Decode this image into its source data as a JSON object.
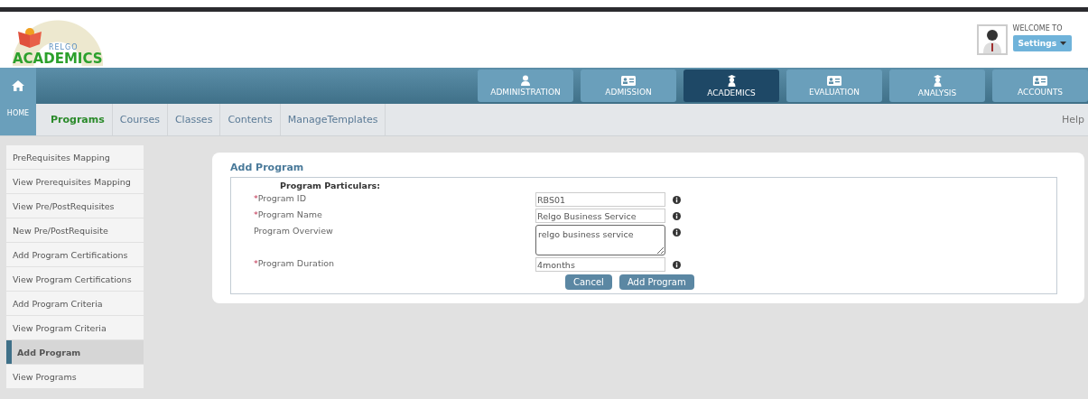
{
  "logo": {
    "brand": "RELGO",
    "name": "ACADEMICS"
  },
  "user": {
    "greeting": "WELCOME TO",
    "menu": "Settings"
  },
  "home": {
    "label": "HOME"
  },
  "modules": [
    {
      "label": "ADMINISTRATION",
      "kind": "person",
      "selected": false
    },
    {
      "label": "ADMISSION",
      "kind": "card",
      "selected": false
    },
    {
      "label": "ACADEMICS",
      "kind": "graduate",
      "selected": true
    },
    {
      "label": "EVALUATION",
      "kind": "card",
      "selected": false
    },
    {
      "label": "ANALYSIS",
      "kind": "graduate",
      "selected": false
    },
    {
      "label": "ACCOUNTS",
      "kind": "card",
      "selected": false
    }
  ],
  "breadcrumbs": [
    {
      "label": "Programs",
      "selected": true
    },
    {
      "label": "Courses",
      "selected": false
    },
    {
      "label": "Classes",
      "selected": false
    },
    {
      "label": "Contents",
      "selected": false
    },
    {
      "label": "ManageTemplates",
      "selected": false
    }
  ],
  "help": "Help",
  "sidebar": {
    "items": [
      {
        "label": "PreRequisites Mapping",
        "selected": false
      },
      {
        "label": "View Prerequisites Mapping",
        "selected": false
      },
      {
        "label": "View Pre/PostRequisites",
        "selected": false
      },
      {
        "label": "New Pre/PostRequisite",
        "selected": false
      },
      {
        "label": "Add Program Certifications",
        "selected": false
      },
      {
        "label": "View Program Certifications",
        "selected": false
      },
      {
        "label": "Add Program Criteria",
        "selected": false
      },
      {
        "label": "View Program Criteria",
        "selected": false
      },
      {
        "label": "Add Program",
        "selected": true
      },
      {
        "label": "View Programs",
        "selected": false
      }
    ]
  },
  "form": {
    "title": "Add Program",
    "section": "Program Particulars:",
    "required_mark": "*",
    "fields": [
      {
        "label": "Program ID",
        "required": true,
        "kind": "input",
        "value": "RBS01"
      },
      {
        "label": "Program Name",
        "required": true,
        "kind": "input",
        "value": "Relgo Business Service"
      },
      {
        "label": "Program Overview",
        "required": false,
        "kind": "textarea",
        "value": "relgo business service"
      },
      {
        "label": "Program Duration",
        "required": true,
        "kind": "input",
        "value": "4months"
      }
    ],
    "buttons": [
      "Cancel",
      "Add Program"
    ]
  }
}
